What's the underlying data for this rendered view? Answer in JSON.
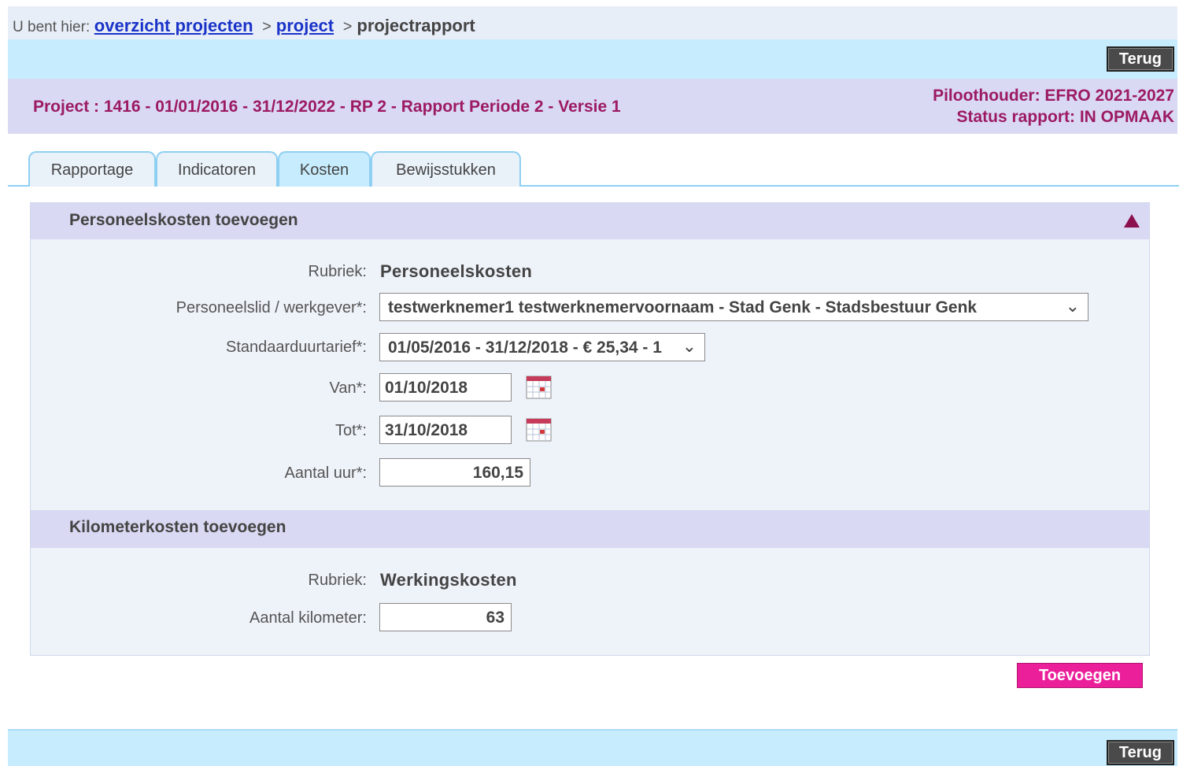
{
  "breadcrumb": {
    "prefix": "U bent hier:",
    "link1": "overzicht projecten",
    "sep": ">",
    "link2": "project",
    "current": "projectrapport"
  },
  "buttons": {
    "back": "Terug",
    "add": "Toevoegen"
  },
  "project": {
    "title": "Project : 1416 - 01/01/2016 - 31/12/2022 - RP 2 - Rapport Periode 2 - Versie 1",
    "pilot_holder": "Piloothouder: EFRO 2021-2027",
    "status": "Status rapport: IN OPMAAK"
  },
  "tabs": [
    {
      "label": "Rapportage",
      "active": false
    },
    {
      "label": "Indicatoren",
      "active": false
    },
    {
      "label": "Kosten",
      "active": true
    },
    {
      "label": "Bewijsstukken",
      "active": false
    }
  ],
  "personnel": {
    "heading": "Personeelskosten toevoegen",
    "rubriek_label": "Rubriek:",
    "rubriek_value": "Personeelskosten",
    "employee_label": "Personeelslid / werkgever*:",
    "employee_value": "testwerknemer1 testwerknemervoornaam - Stad Genk - Stadsbestuur Genk",
    "rate_label": "Standaarduurtarief*:",
    "rate_value": "01/05/2016 - 31/12/2018 - € 25,34 - 1",
    "from_label": "Van*:",
    "from_value": "01/10/2018",
    "to_label": "Tot*:",
    "to_value": "31/10/2018",
    "hours_label": "Aantal uur*:",
    "hours_value": "160,15"
  },
  "kilometer": {
    "heading": "Kilometerkosten toevoegen",
    "rubriek_label": "Rubriek:",
    "rubriek_value": "Werkingskosten",
    "km_label": "Aantal kilometer:",
    "km_value": "63"
  },
  "colors": {
    "accent": "#9c1a63",
    "add_button": "#ec1f9b",
    "bar_blue": "#c6ecfd",
    "section_lavender": "#d9d9f3"
  }
}
